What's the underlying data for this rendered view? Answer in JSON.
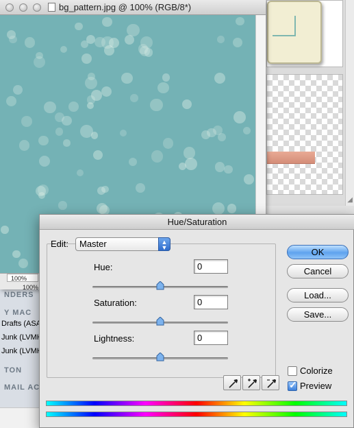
{
  "document": {
    "title": "bg_pattern.jpg @ 100% (RGB/8*)",
    "zoom_top": "100%",
    "zoom_bottom": "100%"
  },
  "background_mail": {
    "section_finders": "NDERS",
    "section_my_mac": "Y MAC",
    "items": [
      "Drafts (ASA",
      "Junk (LVMH",
      "Junk (LVMH"
    ],
    "section_ton": "TON",
    "section_mail": "MAIL AC"
  },
  "dialog": {
    "title": "Hue/Saturation",
    "edit_label": "Edit:",
    "edit_value": "Master",
    "hue": {
      "label": "Hue:",
      "value": "0",
      "level": 0.5
    },
    "saturation": {
      "label": "Saturation:",
      "value": "0",
      "level": 0.5
    },
    "lightness": {
      "label": "Lightness:",
      "value": "0",
      "level": 0.5
    },
    "buttons": {
      "ok": "OK",
      "cancel": "Cancel",
      "load": "Load...",
      "save": "Save..."
    },
    "colorize": {
      "label": "Colorize",
      "checked": false
    },
    "preview": {
      "label": "Preview",
      "checked": true
    },
    "eyedroppers": [
      "eyedropper-icon",
      "eyedropper-plus-icon",
      "eyedropper-minus-icon"
    ]
  },
  "colors": {
    "canvas": "#74b2b5",
    "default_button": "#5fa3ee"
  }
}
